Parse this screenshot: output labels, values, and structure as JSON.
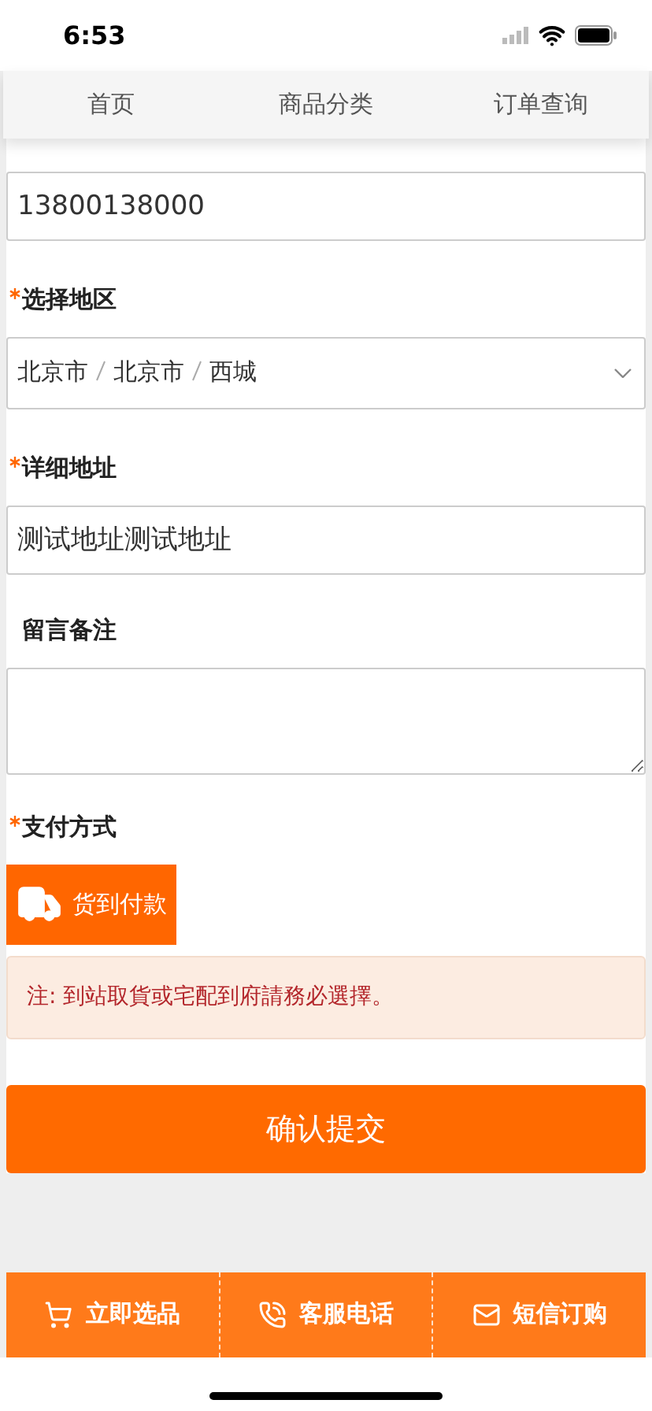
{
  "status_bar": {
    "time": "6:53"
  },
  "nav": [
    {
      "label": "首页"
    },
    {
      "label": "商品分类"
    },
    {
      "label": "订单查询"
    }
  ],
  "form": {
    "phone": {
      "value": "13800138000"
    },
    "region": {
      "label": "选择地区",
      "required": true,
      "parts": [
        "北京市",
        "北京市",
        "西城"
      ]
    },
    "address": {
      "label": "详细地址",
      "required": true,
      "value": "测试地址测试地址"
    },
    "note": {
      "label": "留言备注",
      "required": false
    },
    "payment": {
      "label": "支付方式",
      "required": true,
      "options": [
        {
          "label": "货到付款",
          "selected": true
        }
      ]
    },
    "notice": "注: 到站取貨或宅配到府請務必選擇。",
    "submit": "确认提交"
  },
  "bottom_bar": [
    {
      "kind": "cart",
      "label": "立即选品"
    },
    {
      "kind": "phone",
      "label": "客服电话"
    },
    {
      "kind": "mail",
      "label": "短信订购"
    }
  ]
}
